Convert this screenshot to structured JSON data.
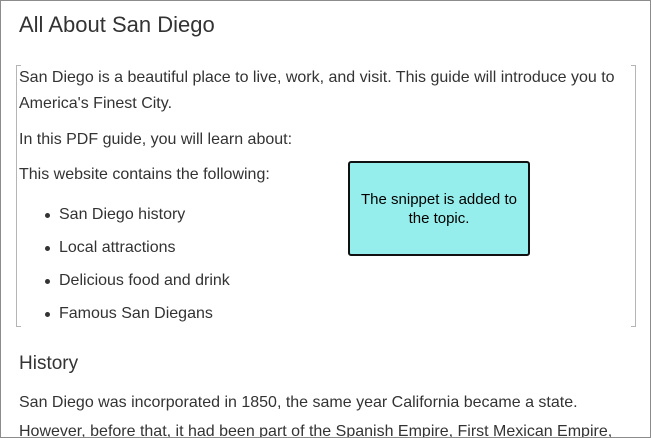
{
  "page": {
    "title": "All About San Diego"
  },
  "snippet": {
    "intro_line1": "San Diego is a beautiful place to live, work, and visit. This guide will introduce you to",
    "intro_line2": "America's Finest City.",
    "pdf_line": "In this PDF guide, you will learn about:",
    "website_line": "This website contains the following:",
    "list_items": [
      "San Diego history",
      "Local attractions",
      "Delicious food and drink",
      "Famous San Diegans"
    ]
  },
  "callout": {
    "text": "The snippet is added to the topic."
  },
  "history": {
    "heading": "History",
    "line1": "San Diego was incorporated in 1850, the same year California became a state.",
    "line2": "However, before that, it had been part of the Spanish Empire, First Mexican Empire,"
  },
  "colors": {
    "callout_fill": "#96eeec",
    "callout_border": "#111111",
    "text": "#333333",
    "snippet_marker": "#b5b5b5"
  }
}
